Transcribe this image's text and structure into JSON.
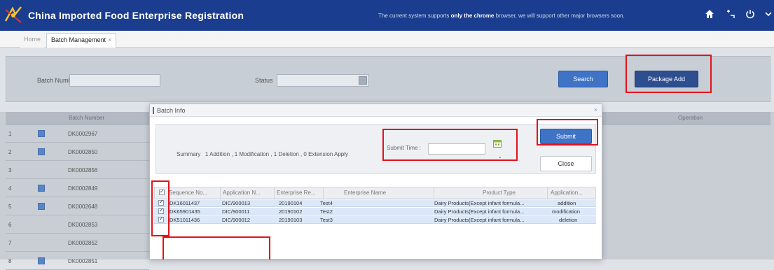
{
  "app": {
    "title": "China Imported Food Enterprise Registration",
    "notice_pre": "The current system supports ",
    "notice_bold1": "only the chrome",
    "notice_post": " browser, we will support other major browsers soon."
  },
  "tabs": [
    {
      "label": "Home"
    },
    {
      "label": "Batch Management",
      "close": "×"
    }
  ],
  "filter": {
    "batch_number_label": "Batch Number",
    "status_label": "Status",
    "search_button": "Search",
    "package_add_button": "Package Add"
  },
  "grid": {
    "header_batch_number": "Batch Number",
    "header_operation": "Operation",
    "rows": [
      {
        "num": "1",
        "batch": "DK0002967",
        "checked": true
      },
      {
        "num": "2",
        "batch": "DK0002850",
        "checked": true
      },
      {
        "num": "3",
        "batch": "DK0002856",
        "checked": false
      },
      {
        "num": "4",
        "batch": "DK0002849",
        "checked": true
      },
      {
        "num": "5",
        "batch": "DK0002648",
        "checked": true
      },
      {
        "num": "6",
        "batch": "DK0002853",
        "checked": false
      },
      {
        "num": "7",
        "batch": "DK0002852",
        "checked": false
      },
      {
        "num": "8",
        "batch": "DK0002851",
        "checked": true
      }
    ]
  },
  "modal": {
    "title": "Batch Info",
    "close_x": "×",
    "summary_label": "Summary",
    "summary_text": "1 Addition , 1 Modification , 1 Deletion , 0 Extension Apply",
    "submit_time_label": "Submit Time :",
    "submit_button": "Submit",
    "close_button": "Close",
    "columns": [
      "Sequence No...",
      "Application N...",
      "Enterprise Re...",
      "Enterprise Name",
      "Product Type",
      "Application..."
    ],
    "rows": [
      {
        "seq": "DK16011437",
        "app_no": "DIC/900013",
        "ent_reg": "20190104",
        "ent_name": "Test4",
        "product": "Dairy Products(Except infant formula...",
        "application": "addition"
      },
      {
        "seq": "DK65901435",
        "app_no": "DIC/900011",
        "ent_reg": "20190102",
        "ent_name": "Test2",
        "product": "Dairy Products(Except infant formula...",
        "application": "modification"
      },
      {
        "seq": "DK51011436",
        "app_no": "DIC/900012",
        "ent_reg": "20190103",
        "ent_name": "Test3",
        "product": "Dairy Products(Except infant formula...",
        "application": "deletion"
      }
    ]
  },
  "colors": {
    "topbar": "#1a3d8f",
    "accent": "#3f73c6",
    "highlight": "#e0141b",
    "row_selected": "#dce8f8"
  }
}
